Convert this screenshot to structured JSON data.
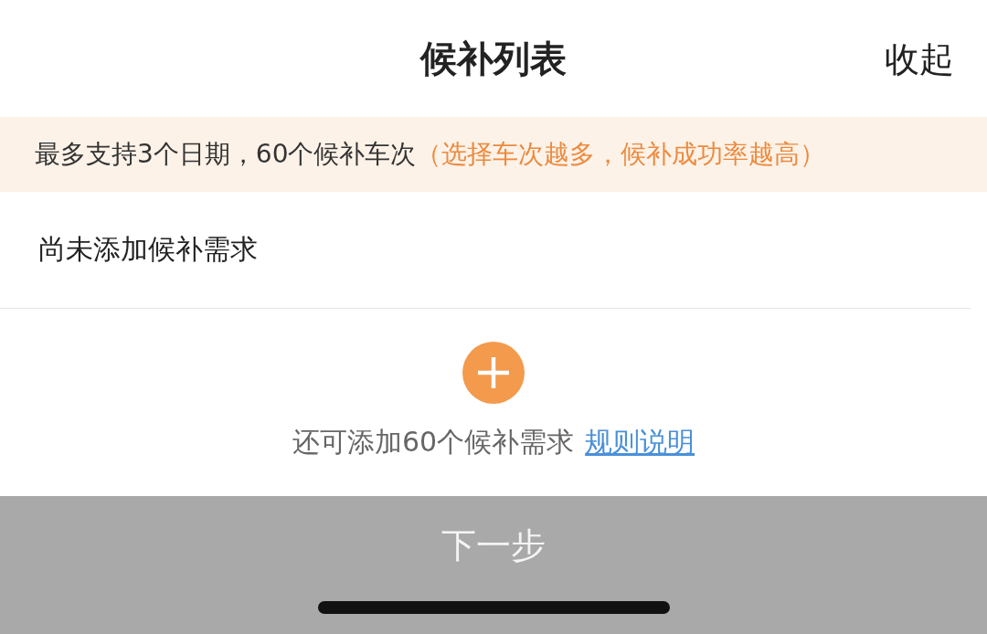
{
  "header": {
    "title": "候补列表",
    "collapse_label": "收起"
  },
  "notice": {
    "text": "最多支持3个日期，60个候补车次",
    "hint": "（选择车次越多，候补成功率越高）"
  },
  "empty_message": "尚未添加候补需求",
  "add": {
    "remaining": "还可添加60个候补需求",
    "rules_link": "规则说明"
  },
  "next_button": {
    "label": "下一步",
    "disabled": true
  }
}
